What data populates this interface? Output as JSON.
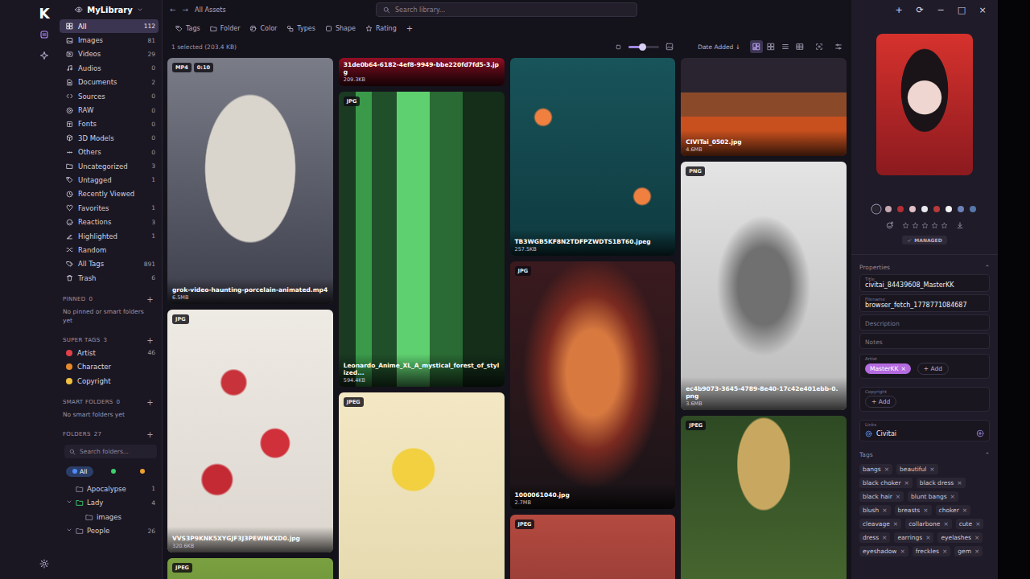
{
  "window": {
    "controls": [
      "+",
      "⟳",
      "−",
      "□",
      "×"
    ]
  },
  "rail": {
    "logo": "K"
  },
  "sidebar": {
    "library": "MyLibrary",
    "items": [
      {
        "label": "All",
        "count": "112",
        "selected": true
      },
      {
        "label": "Images",
        "count": "81",
        "selected": false
      },
      {
        "label": "Videos",
        "count": "29",
        "selected": false
      },
      {
        "label": "Audios",
        "count": "0",
        "selected": false
      },
      {
        "label": "Documents",
        "count": "2",
        "selected": false
      },
      {
        "label": "Sources",
        "count": "0",
        "selected": false
      },
      {
        "label": "RAW",
        "count": "0",
        "selected": false
      },
      {
        "label": "Fonts",
        "count": "0",
        "selected": false
      },
      {
        "label": "3D Models",
        "count": "0",
        "selected": false
      },
      {
        "label": "Others",
        "count": "0",
        "selected": false
      },
      {
        "label": "Uncategorized",
        "count": "3",
        "selected": false
      },
      {
        "label": "Untagged",
        "count": "1",
        "selected": false
      },
      {
        "label": "Recently Viewed",
        "selected": false
      },
      {
        "label": "Favorites",
        "count": "1",
        "selected": false
      },
      {
        "label": "Reactions",
        "count": "3",
        "selected": false
      },
      {
        "label": "Highlighted",
        "count": "1",
        "selected": false
      },
      {
        "label": "Random",
        "selected": false
      },
      {
        "label": "All Tags",
        "count": "891",
        "selected": false
      },
      {
        "label": "Trash",
        "count": "6",
        "selected": false
      }
    ],
    "pinned": {
      "title": "PINNED",
      "count": "0",
      "add": "+",
      "empty": "No pinned or smart folders yet"
    },
    "super_tags": {
      "title": "SUPER TAGS",
      "count": "3",
      "add": "+",
      "items": [
        {
          "label": "Artist",
          "count": "46",
          "color": "#e0404a"
        },
        {
          "label": "Character",
          "color": "#e8892c"
        },
        {
          "label": "Copyright",
          "color": "#f0c040"
        }
      ]
    },
    "smart_folders": {
      "title": "SMART FOLDERS",
      "count": "0",
      "add": "+",
      "empty": "No smart folders yet"
    },
    "folders": {
      "title": "FOLDERS",
      "count": "27",
      "add": "+",
      "search_placeholder": "Search folders...",
      "filters": [
        {
          "label": "All",
          "selected": true,
          "color": "#4f8cf7"
        },
        {
          "selected": false,
          "color": "#3ecf6a"
        },
        {
          "selected": false,
          "color": "#f0a030"
        },
        {
          "selected": false,
          "color": "#bdbdbd"
        }
      ],
      "tree": [
        {
          "label": "Apocalypse",
          "count": "1",
          "depth": 0,
          "expandable": false,
          "expanded": false,
          "color": "#8d869d"
        },
        {
          "label": "Lady",
          "count": "4",
          "depth": 0,
          "expandable": true,
          "expanded": true,
          "color": "#3ecf6a"
        },
        {
          "label": "images",
          "depth": 1,
          "expandable": false,
          "expanded": false,
          "color": "#8d869d"
        },
        {
          "label": "People",
          "count": "26",
          "depth": 0,
          "expandable": true,
          "expanded": true,
          "color": "#8d869d"
        }
      ]
    }
  },
  "toolbar": {
    "back": "←",
    "forward": "→",
    "breadcrumb": "All Assets",
    "search_placeholder": "Search library...",
    "filters": [
      "Tags",
      "Folder",
      "Color",
      "Types",
      "Shape",
      "Rating"
    ],
    "add": "+"
  },
  "status": {
    "selection": "1 selected (203.4 KB)",
    "zoom_level": 0.45,
    "sort": "Date Added ↓",
    "views": [
      {
        "kind": "masonry",
        "selected": true
      },
      {
        "kind": "grid",
        "selected": false
      },
      {
        "kind": "list",
        "selected": false
      },
      {
        "kind": "table",
        "selected": false
      }
    ]
  },
  "grid": {
    "columns": [
      {
        "cards": [
          {
            "type": "MP4",
            "duration": "0:10",
            "name": "grok-video-haunting-porcelain-animated.mp4",
            "size": "6.5MB"
          },
          {
            "type": "JPG",
            "name": "VVS3P9KNK5XYGJF3J3PEWNKXD0.jpg",
            "size": "320.6KB"
          },
          {
            "type": "JPEG"
          }
        ]
      },
      {
        "cards": [
          {
            "name": "31de0b64-6182-4ef8-9949-bbe220fd7fd5-3.jpg",
            "size": "209.3KB"
          },
          {
            "type": "JPG",
            "name": "Leonardo_Anime_XL_A_mystical_forest_of_stylized...",
            "size": "594.4KB"
          },
          {
            "type": "JPEG"
          }
        ]
      },
      {
        "cards": [
          {
            "name": "TB3WGB5KF8N2TDFPZWDTS1BT60.jpeg",
            "size": "257.5KB"
          },
          {
            "type": "JPG",
            "name": "1000061040.jpg",
            "size": "2.7MB"
          },
          {
            "type": "JPEG"
          }
        ]
      },
      {
        "cards": [
          {
            "name": "CIVITai_0502.jpg",
            "size": "4.6MB"
          },
          {
            "type": "PNG",
            "name": "ec4b9073-3645-4789-8e40-17c42e401ebb-0.png",
            "size": "3.6MB"
          },
          {
            "type": "JPEG"
          }
        ]
      }
    ]
  },
  "inspector": {
    "palette": [
      {
        "color": "#2a2630",
        "selected": true
      },
      {
        "color": "#c9a9b0",
        "selected": false
      },
      {
        "color": "#b52d35",
        "selected": false
      },
      {
        "color": "#e0c0c6",
        "selected": false
      },
      {
        "color": "#e8e8ee",
        "selected": false
      },
      {
        "color": "#b83a3a",
        "selected": false
      },
      {
        "color": "#f4f4f6",
        "selected": false
      },
      {
        "color": "#6b82b8",
        "selected": false
      },
      {
        "color": "#5577aa",
        "selected": false
      }
    ],
    "rating": {
      "stars": 0,
      "max": 5
    },
    "managed": "MANAGED",
    "properties": {
      "title": "Properties",
      "collapse": "⌃",
      "fields": [
        {
          "label": "Title",
          "value": "civitai_84439608_MasterKK"
        },
        {
          "label": "Filename",
          "value": "browser_fetch_1778771084687"
        },
        {
          "placeholder": "Description"
        },
        {
          "placeholder": "Notes"
        }
      ]
    },
    "artist": {
      "label": "Artist",
      "tags": [
        "MasterKK"
      ],
      "remove": "×",
      "add": "+ Add"
    },
    "copyright": {
      "label": "Copyright",
      "add": "+ Add"
    },
    "links": {
      "label": "Links",
      "items": [
        "Civitai"
      ]
    },
    "tags": {
      "title": "Tags",
      "collapse": "⌃",
      "remove": "×",
      "items": [
        "bangs",
        "beautiful",
        "black choker",
        "black dress",
        "black hair",
        "blunt bangs",
        "blush",
        "breasts",
        "choker",
        "cleavage",
        "collarbone",
        "cute",
        "dress",
        "earrings",
        "eyelashes",
        "eyeshadow",
        "freckles",
        "gem"
      ]
    }
  }
}
